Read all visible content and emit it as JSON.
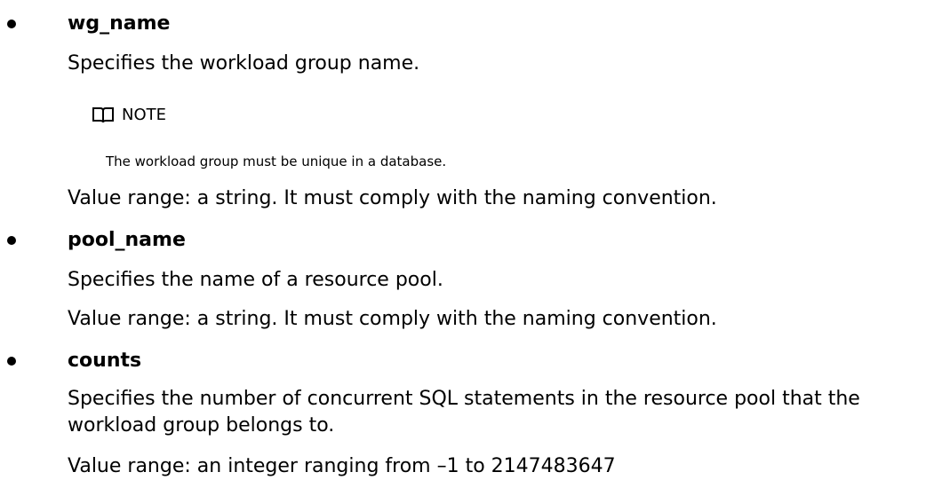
{
  "params": [
    {
      "name": "wg_name",
      "description": "Specifies the workload group name.",
      "note": {
        "label": "NOTE",
        "text": "The workload group must be unique in a database."
      },
      "value_range": "Value range: a string. It must comply with the naming convention."
    },
    {
      "name": "pool_name",
      "description": "Specifies the name of a resource pool.",
      "value_range": "Value range: a string. It must comply with the naming convention."
    },
    {
      "name": "counts",
      "description": "Specifies the number of concurrent SQL statements in the resource pool that the workload group belongs to.",
      "value_range": "Value range: an integer ranging from –1 to 2147483647"
    }
  ],
  "icons": {
    "note_icon": "book-icon"
  }
}
